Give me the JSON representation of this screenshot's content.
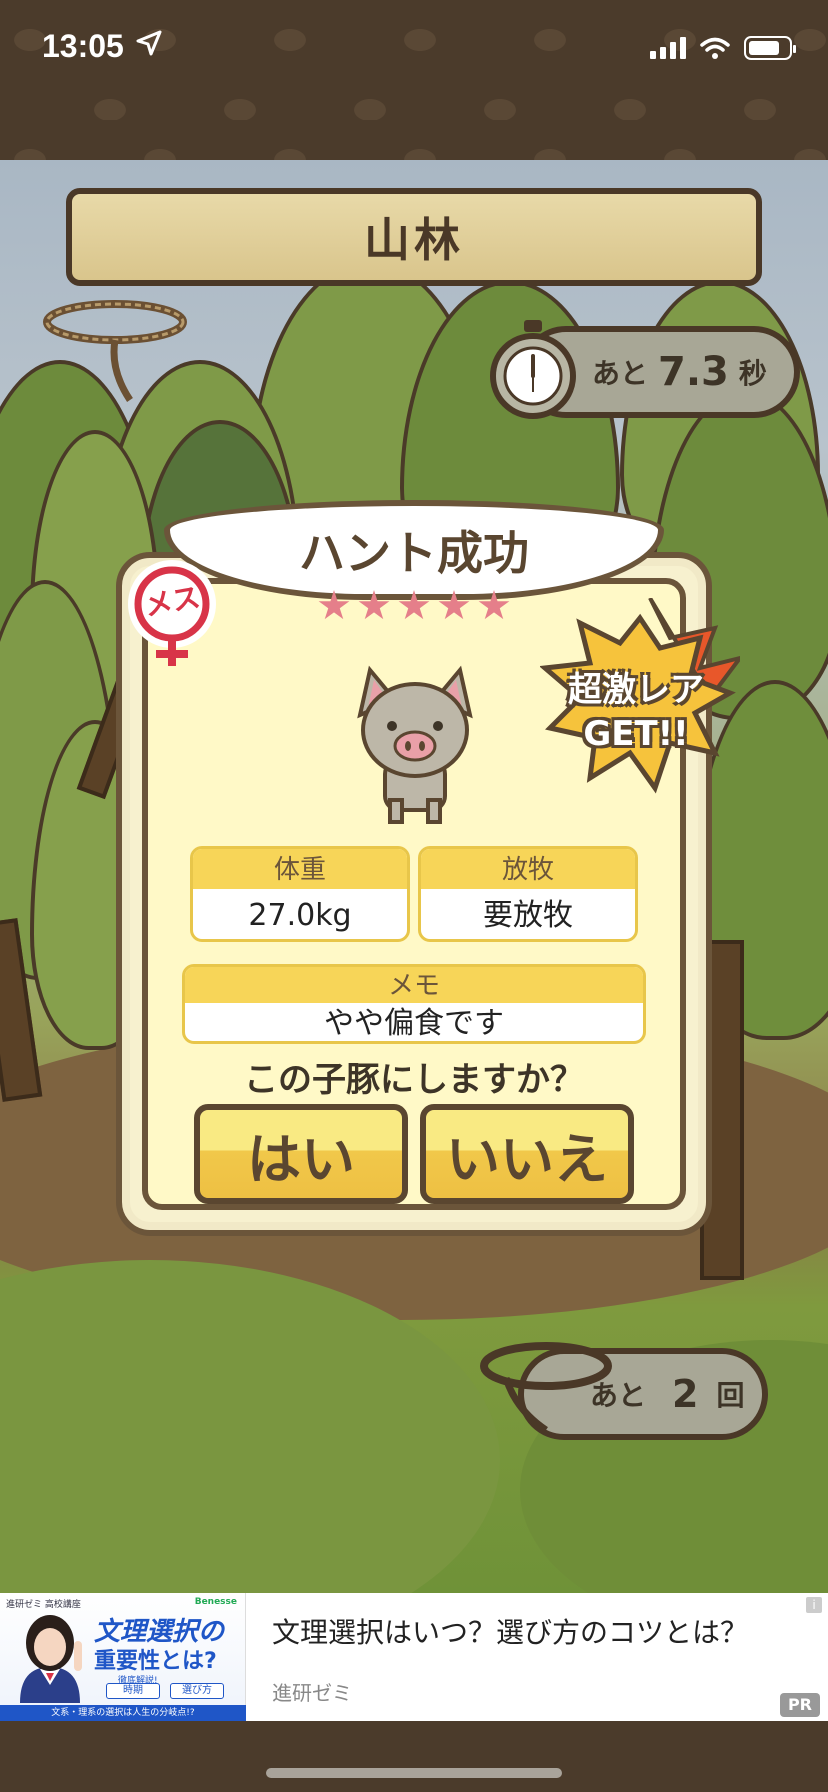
{
  "status_bar": {
    "time": "13:05",
    "location_icon": "location-arrow-icon",
    "signal_icon": "cellular-signal-icon",
    "wifi_icon": "wifi-icon",
    "battery_icon": "battery-icon"
  },
  "game": {
    "area_title": "山林",
    "timer": {
      "prefix": "あと",
      "value": "7.3",
      "suffix": "秒"
    },
    "result": {
      "banner": "ハント成功",
      "stars": 5,
      "gender_badge": "メス",
      "rare_badge": [
        "超激レア",
        "GET!!"
      ],
      "weight_label": "体重",
      "weight_value": "27.0kg",
      "grazing_label": "放牧",
      "grazing_value": "要放牧",
      "memo_label": "メモ",
      "memo_value": "やや偏食です",
      "question": "この子豚にしますか？",
      "yes_label": "はい",
      "no_label": "いいえ"
    },
    "remaining": {
      "prefix": "あと",
      "value": "2",
      "suffix": "回"
    }
  },
  "ad": {
    "image_top_text": "進研ゼミ 高校講座",
    "image_brand": "Benesse",
    "image_headline_1": "文理選択の",
    "image_headline_2": "重要性とは?",
    "image_sub": "徹底解説!",
    "image_btn_1": "時期",
    "image_btn_2": "選び方",
    "image_footer": "文系・理系の選択は人生の分岐点!?",
    "headline": "文理選択はいつ？選び方のコツとは？",
    "source": "進研ゼミ",
    "info_icon": "info-icon",
    "pr_label": "PR"
  },
  "colors": {
    "frame_brown": "#4b3b2b",
    "outline_brown": "#5a4630",
    "dialog_bg": "#fff9c7",
    "label_yellow": "#f7d558",
    "star_pink": "#e57f8a",
    "rare_orange": "#e8572a"
  }
}
